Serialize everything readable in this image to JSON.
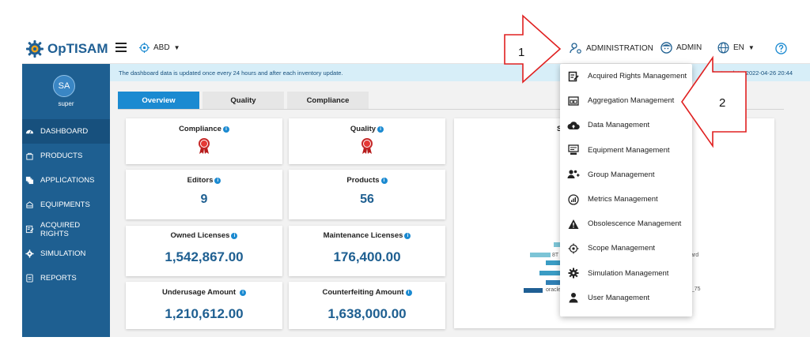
{
  "app": {
    "name": "OpTISAM"
  },
  "header": {
    "scope": "ABD",
    "administration": "ADMINISTRATION",
    "admin": "ADMIN",
    "language": "EN"
  },
  "user": {
    "initials": "SA",
    "name": "super"
  },
  "sidebar": {
    "items": [
      {
        "label": "DASHBOARD",
        "icon": "dashboard-icon"
      },
      {
        "label": "PRODUCTS",
        "icon": "products-icon"
      },
      {
        "label": "APPLICATIONS",
        "icon": "applications-icon"
      },
      {
        "label": "EQUIPMENTS",
        "icon": "equipments-icon"
      },
      {
        "label": "ACQUIRED RIGHTS",
        "icon": "acquired-rights-icon"
      },
      {
        "label": "SIMULATION",
        "icon": "simulation-icon"
      },
      {
        "label": "REPORTS",
        "icon": "reports-icon"
      }
    ]
  },
  "infobar": {
    "message": "The dashboard data is updated once every 24 hours and after each inventory update.",
    "next_update": "Next update: 2022-04-26 20:44"
  },
  "tabs": [
    "Overview",
    "Quality",
    "Compliance"
  ],
  "cards": {
    "compliance": {
      "title": "Compliance"
    },
    "quality": {
      "title": "Quality"
    },
    "editors": {
      "title": "Editors",
      "value": "9"
    },
    "products": {
      "title": "Products",
      "value": "56"
    },
    "owned_licenses": {
      "title": "Owned Licenses",
      "value": "1,542,867.00"
    },
    "maintenance_licenses": {
      "title": "Maintenance Licenses",
      "value": "176,400.00"
    },
    "underusage_amount": {
      "title": "Underusage Amount",
      "value": "1,210,612.00"
    },
    "counterfeiting_amount": {
      "title": "Counterfeiting Amount",
      "value": "1,638,000.00"
    }
  },
  "chart_partial": {
    "title_visible": "S",
    "labels": [
      "8T",
      "oracle",
      "ard",
      "u_75"
    ]
  },
  "dropdown": {
    "items": [
      {
        "label": "Acquired Rights Management",
        "icon": "acquired-rights-management-icon"
      },
      {
        "label": "Aggregation Management",
        "icon": "aggregation-management-icon"
      },
      {
        "label": "Data Management",
        "icon": "cloud-upload-icon"
      },
      {
        "label": "Equipment Management",
        "icon": "equipment-management-icon"
      },
      {
        "label": "Group Management",
        "icon": "group-management-icon"
      },
      {
        "label": "Metrics Management",
        "icon": "metrics-management-icon"
      },
      {
        "label": "Obsolescence Management",
        "icon": "warning-icon"
      },
      {
        "label": "Scope Management",
        "icon": "scope-management-icon"
      },
      {
        "label": "Simulation Management",
        "icon": "gear-icon"
      },
      {
        "label": "User Management",
        "icon": "user-icon"
      }
    ]
  },
  "annotations": {
    "callout_1": "1",
    "callout_2": "2"
  },
  "colors": {
    "sidebar": "#1e5f91",
    "accent": "#1b8ad1",
    "infobar": "#d7eef8"
  }
}
